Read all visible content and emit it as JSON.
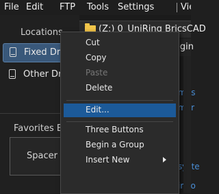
{
  "menubar": {
    "items": [
      "File",
      "Edit",
      "FTP",
      "Tools",
      "Settings",
      "View"
    ]
  },
  "left": {
    "locations_title": "Locations",
    "drives": [
      {
        "label": "Fixed Drives",
        "selected": true
      },
      {
        "label": "Other Drives",
        "selected": false
      }
    ],
    "favorites_title": "Favorites Bar",
    "spacer_label": "Spacer"
  },
  "tab": {
    "title": "(Z:) 0_UniRing BricsCAD"
  },
  "nav": {
    "path": "Begin"
  },
  "right_fragments": [
    "mps",
    "mer",
    "syste",
    "indo"
  ],
  "context_menu": {
    "items": [
      {
        "label": "Cut",
        "enabled": true
      },
      {
        "label": "Copy",
        "enabled": true
      },
      {
        "label": "Paste",
        "enabled": false
      },
      {
        "label": "Delete",
        "enabled": true
      },
      {
        "label": "Edit...",
        "enabled": true,
        "highlighted": true
      },
      {
        "label": "Three Buttons",
        "enabled": true
      },
      {
        "label": "Begin a Group",
        "enabled": true
      },
      {
        "label": "Insert New",
        "enabled": true,
        "submenu": true
      }
    ]
  },
  "colors": {
    "highlight": "#1c5a99",
    "selected_drive": "#39587a",
    "link_blue": "#4a8ed6",
    "folder": "#f4c64a"
  }
}
